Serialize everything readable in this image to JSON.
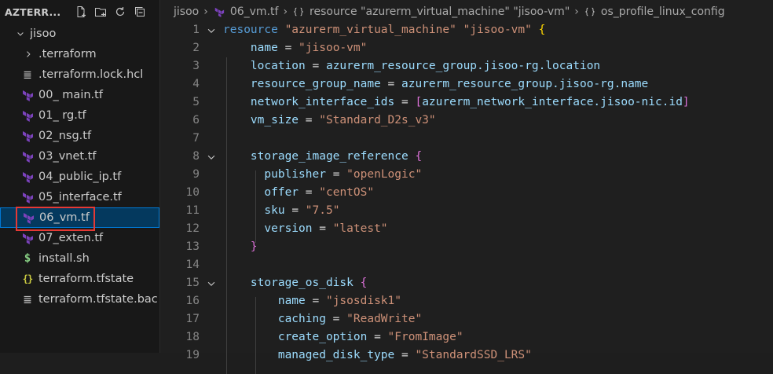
{
  "sidebar": {
    "title": "AZTERR...",
    "header_icons": [
      "new-file-icon",
      "new-folder-icon",
      "refresh-icon",
      "collapse-all-icon"
    ],
    "root_folder": "jisoo",
    "items": [
      {
        "label": ".terraform",
        "kind": "folder",
        "icon": "chevron-right-icon"
      },
      {
        "label": ".terraform.lock.hcl",
        "kind": "file",
        "icon": "lines-icon"
      },
      {
        "label": "00_ main.tf",
        "kind": "file",
        "icon": "terraform-icon"
      },
      {
        "label": "01_ rg.tf",
        "kind": "file",
        "icon": "terraform-icon"
      },
      {
        "label": "02_nsg.tf",
        "kind": "file",
        "icon": "terraform-icon"
      },
      {
        "label": "03_vnet.tf",
        "kind": "file",
        "icon": "terraform-icon"
      },
      {
        "label": "04_public_ip.tf",
        "kind": "file",
        "icon": "terraform-icon"
      },
      {
        "label": "05_interface.tf",
        "kind": "file",
        "icon": "terraform-icon"
      },
      {
        "label": "06_vm.tf",
        "kind": "file",
        "icon": "terraform-icon",
        "selected": true
      },
      {
        "label": "07_exten.tf",
        "kind": "file",
        "icon": "terraform-icon"
      },
      {
        "label": "install.sh",
        "kind": "file",
        "icon": "shell-icon"
      },
      {
        "label": "terraform.tfstate",
        "kind": "file",
        "icon": "json-braces-icon"
      },
      {
        "label": "terraform.tfstate.bac...",
        "kind": "file",
        "icon": "lines-icon"
      }
    ]
  },
  "breadcrumb": {
    "folder": "jisoo",
    "file": "06_vm.tf",
    "resource": "resource \"azurerm_virtual_machine\" \"jisoo-vm\"",
    "block": "os_profile_linux_config"
  },
  "editor": {
    "lines": [
      {
        "n": "1",
        "fold": true,
        "tokens": [
          [
            "kw",
            "resource"
          ],
          [
            "op",
            " "
          ],
          [
            "str",
            "\"azurerm_virtual_machine\""
          ],
          [
            "op",
            " "
          ],
          [
            "str",
            "\"jisoo-vm\""
          ],
          [
            "op",
            " "
          ],
          [
            "br1",
            "{"
          ]
        ]
      },
      {
        "n": "2",
        "tokens": [
          [
            "op",
            "    "
          ],
          [
            "prop",
            "name"
          ],
          [
            "op",
            " = "
          ],
          [
            "str",
            "\"jisoo-vm\""
          ]
        ]
      },
      {
        "n": "3",
        "tokens": [
          [
            "op",
            "    "
          ],
          [
            "prop",
            "location"
          ],
          [
            "op",
            " = "
          ],
          [
            "prop",
            "azurerm_resource_group.jisoo-rg.location"
          ]
        ]
      },
      {
        "n": "4",
        "tokens": [
          [
            "op",
            "    "
          ],
          [
            "prop",
            "resource_group_name"
          ],
          [
            "op",
            " = "
          ],
          [
            "prop",
            "azurerm_resource_group.jisoo-rg.name"
          ]
        ]
      },
      {
        "n": "5",
        "tokens": [
          [
            "op",
            "    "
          ],
          [
            "prop",
            "network_interface_ids"
          ],
          [
            "op",
            " = "
          ],
          [
            "br2",
            "["
          ],
          [
            "prop",
            "azurerm_network_interface.jisoo-nic.id"
          ],
          [
            "br2",
            "]"
          ]
        ]
      },
      {
        "n": "6",
        "tokens": [
          [
            "op",
            "    "
          ],
          [
            "prop",
            "vm_size"
          ],
          [
            "op",
            " = "
          ],
          [
            "str",
            "\"Standard_D2s_v3\""
          ]
        ]
      },
      {
        "n": "7",
        "tokens": []
      },
      {
        "n": "8",
        "fold": true,
        "tokens": [
          [
            "op",
            "    "
          ],
          [
            "prop",
            "storage_image_reference"
          ],
          [
            "op",
            " "
          ],
          [
            "br2",
            "{"
          ]
        ]
      },
      {
        "n": "9",
        "tokens": [
          [
            "op",
            "      "
          ],
          [
            "prop",
            "publisher"
          ],
          [
            "op",
            " = "
          ],
          [
            "str",
            "\"openLogic\""
          ]
        ]
      },
      {
        "n": "10",
        "tokens": [
          [
            "op",
            "      "
          ],
          [
            "prop",
            "offer"
          ],
          [
            "op",
            " = "
          ],
          [
            "str",
            "\"centOS\""
          ]
        ]
      },
      {
        "n": "11",
        "tokens": [
          [
            "op",
            "      "
          ],
          [
            "prop",
            "sku"
          ],
          [
            "op",
            " = "
          ],
          [
            "str",
            "\"7.5\""
          ]
        ]
      },
      {
        "n": "12",
        "tokens": [
          [
            "op",
            "      "
          ],
          [
            "prop",
            "version"
          ],
          [
            "op",
            " = "
          ],
          [
            "str",
            "\"latest\""
          ]
        ]
      },
      {
        "n": "13",
        "tokens": [
          [
            "op",
            "    "
          ],
          [
            "br2",
            "}"
          ]
        ]
      },
      {
        "n": "14",
        "tokens": []
      },
      {
        "n": "15",
        "fold": true,
        "tokens": [
          [
            "op",
            "    "
          ],
          [
            "prop",
            "storage_os_disk"
          ],
          [
            "op",
            " "
          ],
          [
            "br2",
            "{"
          ]
        ]
      },
      {
        "n": "16",
        "tokens": [
          [
            "op",
            "        "
          ],
          [
            "prop",
            "name"
          ],
          [
            "op",
            " = "
          ],
          [
            "str",
            "\"jsosdisk1\""
          ]
        ]
      },
      {
        "n": "17",
        "tokens": [
          [
            "op",
            "        "
          ],
          [
            "prop",
            "caching"
          ],
          [
            "op",
            " = "
          ],
          [
            "str",
            "\"ReadWrite\""
          ]
        ]
      },
      {
        "n": "18",
        "tokens": [
          [
            "op",
            "        "
          ],
          [
            "prop",
            "create_option"
          ],
          [
            "op",
            " = "
          ],
          [
            "str",
            "\"FromImage\""
          ]
        ]
      },
      {
        "n": "19",
        "tokens": [
          [
            "op",
            "        "
          ],
          [
            "prop",
            "managed_disk_type"
          ],
          [
            "op",
            " = "
          ],
          [
            "str",
            "\"StandardSSD_LRS\""
          ]
        ]
      }
    ]
  },
  "colors": {
    "keyword": "#569cd6",
    "string": "#ce9178",
    "property": "#9cdcfe",
    "bracket_yellow": "#ffd700",
    "bracket_purple": "#da70d6",
    "terraform_icon": "#7b42bc",
    "selection": "#04395e",
    "highlight_box": "#e53935"
  }
}
